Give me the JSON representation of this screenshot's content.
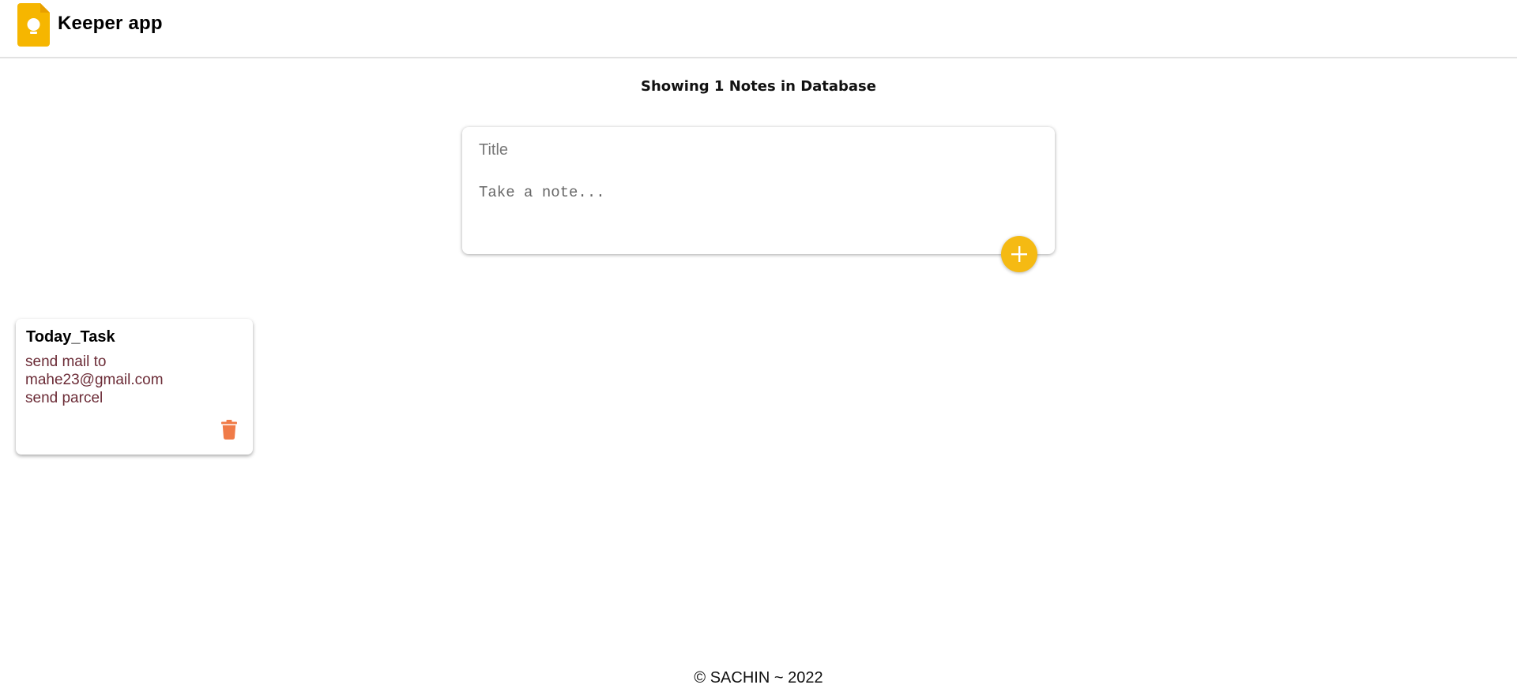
{
  "header": {
    "logo_icon": "keep-bulb-icon",
    "title": "Keeper app"
  },
  "main": {
    "count_text": "Showing 1 Notes in Database"
  },
  "create_form": {
    "title_placeholder": "Title",
    "title_value": "",
    "content_placeholder": "Take a note...",
    "content_value": "",
    "add_icon": "plus-icon"
  },
  "notes": [
    {
      "title": "Today_Task",
      "content": "send mail to\nmahe23@gmail.com\nsend parcel",
      "delete_icon": "trash-icon"
    }
  ],
  "footer": {
    "text": "© SACHIN ~ 2022"
  },
  "colors": {
    "accent": "#f5ba13",
    "note_text": "#6b2b36",
    "delete": "#f07b48"
  }
}
